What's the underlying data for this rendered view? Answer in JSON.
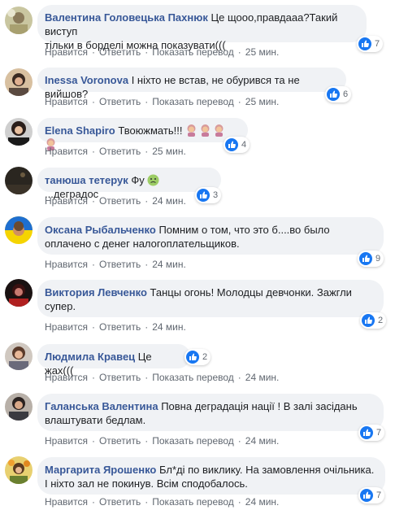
{
  "colors": {
    "name": "#385898",
    "bubble": "#f0f2f5",
    "meta": "#606770",
    "like": "#1877f2"
  },
  "comments": [
    {
      "name": "Валентина Головецька Пахнюк",
      "text_line1": "Це щооо,правдааа?Такий виступ",
      "text_line2": "тільки в борделі можна показувати(((",
      "reaction_icon": "like-icon",
      "reaction_count": "7",
      "like": "Нравится",
      "reply": "Ответить",
      "translate": "Показать перевод",
      "time": "25 мин."
    },
    {
      "name": "Inessa Voronova",
      "text": "І ніхто не встав, не обурився та не вийшов?",
      "reaction_icon": "like-icon",
      "reaction_count": "6",
      "like": "Нравится",
      "reply": "Ответить",
      "translate": "Показать перевод",
      "time": "25 мин."
    },
    {
      "name": "Elena Shapiro",
      "text": "Твоюжмать!!!",
      "reaction_icon": "like-icon",
      "reaction_count": "4",
      "like": "Нравится",
      "reply": "Ответить",
      "time": "25 мин."
    },
    {
      "name": "танюша тетерук",
      "text_before": "Фу",
      "text_after": "...деградос",
      "reaction_icon": "like-icon",
      "reaction_count": "3",
      "like": "Нравится",
      "reply": "Ответить",
      "time": "24 мин."
    },
    {
      "name": "Оксана Рыбальченко",
      "text_line1": "Помним о том, что это б....во было",
      "text_line2": "оплачено с денег налогоплательщиков.",
      "reaction_icon": "like-icon",
      "reaction_count": "9",
      "like": "Нравится",
      "reply": "Ответить",
      "time": "24 мин."
    },
    {
      "name": "Виктория Левченко",
      "text_line1": "Танцы огонь! Молодцы девчонки. Зажгли",
      "text_line2": "супер.",
      "reaction_icon": "like-icon",
      "reaction_count": "2",
      "like": "Нравится",
      "reply": "Ответить",
      "time": "24 мин."
    },
    {
      "name": "Людмила Кравец",
      "text": "Це жах(((",
      "reaction_icon": "like-icon",
      "reaction_count": "2",
      "like": "Нравится",
      "reply": "Ответить",
      "translate": "Показать перевод",
      "time": "24 мин."
    },
    {
      "name": "Галанська Валентина",
      "text_line1": "Повна деградація нації ! В залі засідань",
      "text_line2": "влаштувати бедлам.",
      "reaction_icon": "like-icon",
      "reaction_count": "7",
      "like": "Нравится",
      "reply": "Ответить",
      "translate": "Показать перевод",
      "time": "24 мин."
    },
    {
      "name": "Маргарита Ярошенко",
      "text_line1": "Бл*ді по виклику. На замовлення очільника.",
      "text_line2": "І ніхто зал не покинув. Всім сподобалось.",
      "reaction_icon": "like-icon",
      "reaction_count": "7",
      "like": "Нравится",
      "reply": "Ответить",
      "translate": "Показать перевод",
      "time": "24 мин."
    }
  ]
}
